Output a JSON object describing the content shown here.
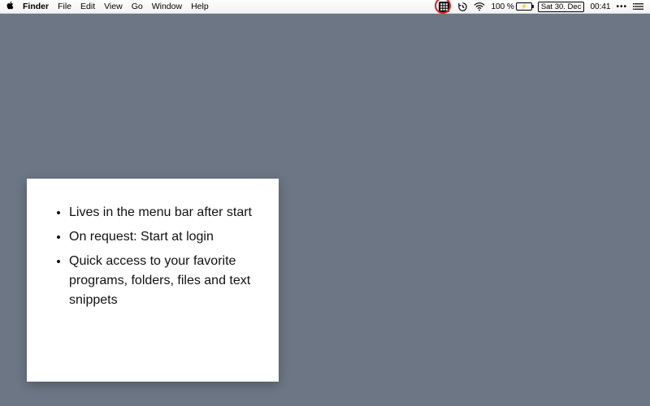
{
  "menubar": {
    "app": "Finder",
    "menus": [
      "File",
      "Edit",
      "View",
      "Go",
      "Window",
      "Help"
    ]
  },
  "status": {
    "battery_pct": "100 %",
    "date": "Sat 30. Dec",
    "time": "00:41"
  },
  "card": {
    "bullets": [
      "Lives in the menu bar after start",
      "On request: Start at login",
      "Quick access to your favorite programs, folders, files and text snippets"
    ]
  }
}
